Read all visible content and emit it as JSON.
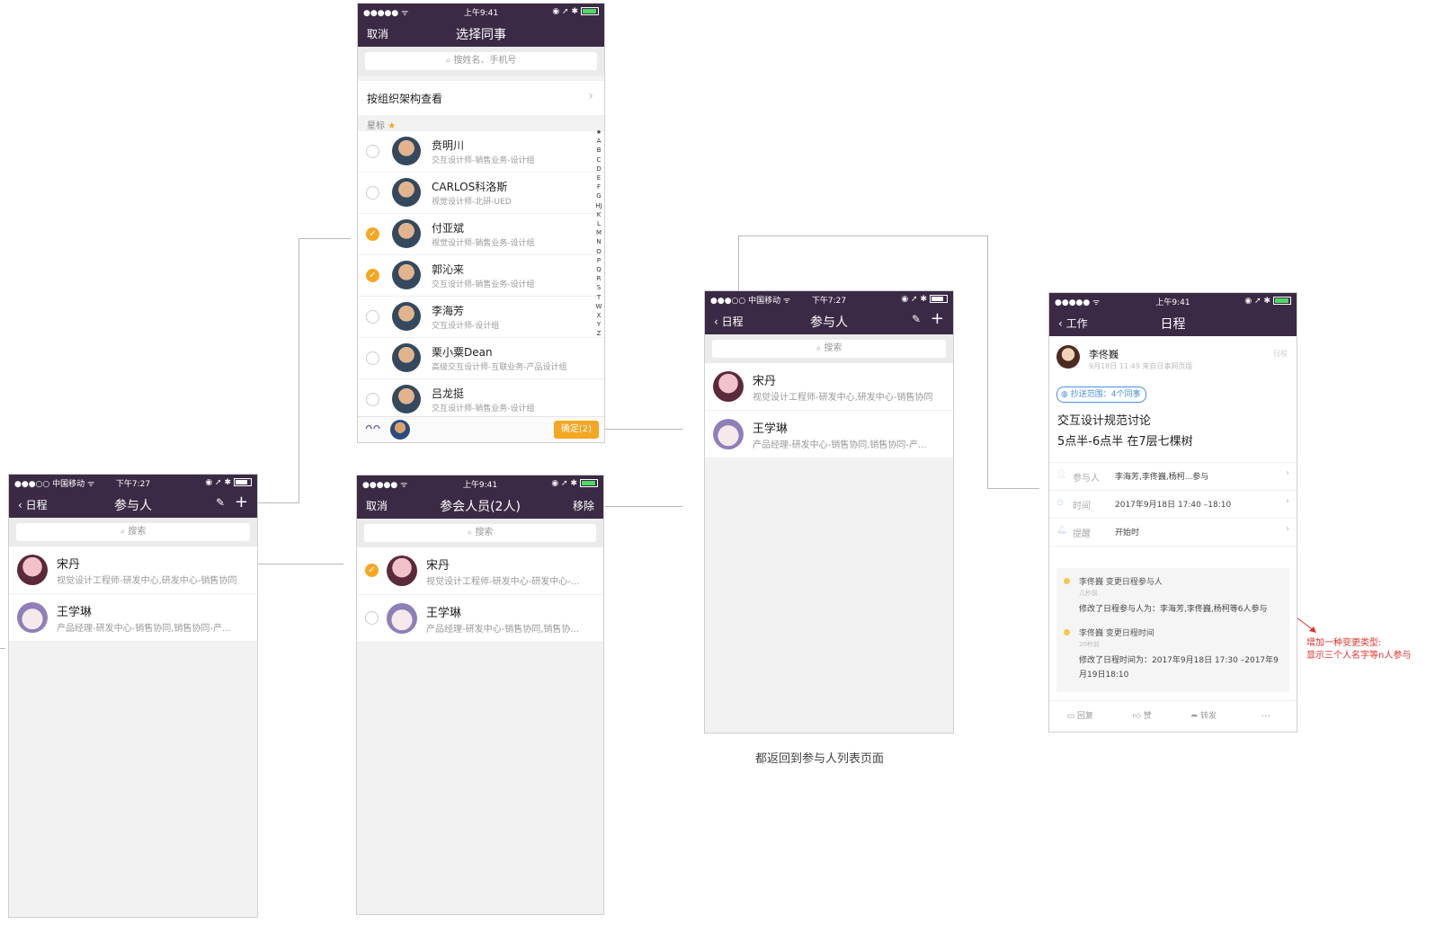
{
  "screenA": {
    "status": {
      "carrier": "●●●○○ 中国移动 ᯤ",
      "time": "下午7:27",
      "icons": "◉ ➚ ✱"
    },
    "nav": {
      "back": "日程",
      "title": "参与人",
      "edit": "✎",
      "add": "+"
    },
    "search_placeholder": "搜索",
    "people": [
      {
        "name": "宋丹",
        "desc": "视觉设计工程师-研发中心,研发中心-销售协同"
      },
      {
        "name": "王学琳",
        "desc": "产品经理-研发中心-销售协同,销售协同-产..."
      }
    ]
  },
  "screenB": {
    "status": {
      "carrier": "●●●●● ᯤ",
      "time": "上午9:41",
      "icons": "◉ ➚ ✱"
    },
    "nav": {
      "left": "取消",
      "title": "选择同事"
    },
    "search_placeholder": "搜姓名、手机号",
    "org_link": "按组织架构查看",
    "section": "星标",
    "section_star": "★",
    "index_letters": "★ABCDEFGHJKLMNOPQRSTWXYZ",
    "people": [
      {
        "name": "贲明川",
        "desc": "交互设计师-销售业务-设计组",
        "checked": false
      },
      {
        "name": "CARLOS科洛斯",
        "desc": "视觉设计师-北研-UED",
        "checked": false
      },
      {
        "name": "付亚斌",
        "desc": "视觉设计师-销售业务-设计组",
        "checked": true
      },
      {
        "name": "郭沁来",
        "desc": "交互设计师-销售业务-设计组",
        "checked": true
      },
      {
        "name": "李海芳",
        "desc": "交互设计师-设计组",
        "checked": false
      },
      {
        "name": "栗小粟Dean",
        "desc": "高级交互设计师-互联业务-产品设计组",
        "checked": false
      },
      {
        "name": "吕龙挺",
        "desc": "交互设计师-销售业务-设计组",
        "checked": false
      }
    ],
    "confirm": "确定(2)"
  },
  "screenC": {
    "status": {
      "carrier": "●●●●● ᯤ",
      "time": "上午9:41",
      "icons": "◉ ➚ ✱"
    },
    "nav": {
      "left": "取消",
      "title": "参会人员(2人)",
      "right": "移除"
    },
    "search_placeholder": "搜索",
    "people": [
      {
        "name": "宋丹",
        "desc": "视觉设计工程师-研发中心-研发中心-...",
        "checked": true
      },
      {
        "name": "王学琳",
        "desc": "产品经理-研发中心-销售协同,销售协...",
        "checked": false
      }
    ]
  },
  "screenD": {
    "status": {
      "carrier": "●●●○○ 中国移动 ᯤ",
      "time": "下午7:27",
      "icons": "◉ ➚ ✱"
    },
    "nav": {
      "back": "日程",
      "title": "参与人",
      "edit": "✎",
      "add": "+"
    },
    "search_placeholder": "搜索",
    "people": [
      {
        "name": "宋丹",
        "desc": "视觉设计工程师-研发中心,研发中心-销售协同"
      },
      {
        "name": "王学琳",
        "desc": "产品经理-研发中心-销售协同,销售协同-产..."
      }
    ],
    "caption": "都返回到参与人列表页面"
  },
  "screenE": {
    "status": {
      "carrier": "●●●●● ᯤ",
      "time": "上午9:41",
      "icons": "◉ ➚ ✱"
    },
    "nav": {
      "back": "工作",
      "title": "日程"
    },
    "author": "李佟巍",
    "meta": "9月18日 11:49  来自日事网页版",
    "tag": "日程",
    "scope": "抄送范围：4个同事",
    "title_line1": "交互设计规范讨论",
    "title_line2": "5点半-6点半 在7层七棵树",
    "rows": [
      {
        "label": "参与人",
        "value": "李海芳,李佟巍,杨柯...参与"
      },
      {
        "label": "时间",
        "value": "2017年9月18日 17:40 –18:10"
      },
      {
        "label": "提醒",
        "value": "开始时"
      }
    ],
    "log": [
      {
        "who": "李佟巍 变更日程参与人",
        "when": "几秒前",
        "text": "修改了日程参与人为：李海芳,李佟巍,杨柯等6人参与"
      },
      {
        "who": "李佟巍 变更日程时间",
        "when": "20秒前",
        "text": "修改了日程时间为：2017年9月18日 17:30 –2017年9月19日18:10"
      }
    ],
    "actions": [
      "回复",
      "赞",
      "转发",
      "···"
    ]
  },
  "annotation": "增加一种变更类型:\n显示三个人名字等n人参与"
}
